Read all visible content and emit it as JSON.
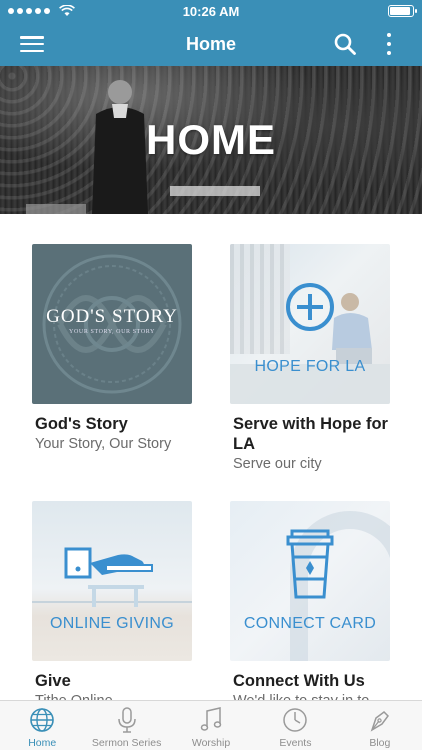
{
  "status_bar": {
    "time": "10:26 AM"
  },
  "nav": {
    "title": "Home"
  },
  "hero": {
    "title": "HOME"
  },
  "tiles": [
    {
      "image_title": "GOD'S STORY",
      "image_subtitle": "YOUR STORY, OUR STORY",
      "title": "God's Story",
      "subtitle": "Your Story, Our Story"
    },
    {
      "image_label": "HOPE FOR LA",
      "title": "Serve with Hope for LA",
      "subtitle": "Serve our city"
    },
    {
      "image_label": "ONLINE GIVING",
      "title": "Give",
      "subtitle": "Tithe Online"
    },
    {
      "image_label": "CONNECT CARD",
      "title": "Connect With Us",
      "subtitle": "We'd like to stay in to..."
    }
  ],
  "tabs": [
    {
      "label": "Home",
      "icon": "globe-icon",
      "active": true
    },
    {
      "label": "Sermon Series",
      "icon": "microphone-icon",
      "active": false
    },
    {
      "label": "Worship",
      "icon": "music-note-icon",
      "active": false
    },
    {
      "label": "Events",
      "icon": "clock-icon",
      "active": false
    },
    {
      "label": "Blog",
      "icon": "pen-nib-icon",
      "active": false
    }
  ],
  "colors": {
    "brand": "#3a8fb7",
    "tile_accent": "#3a8fcf",
    "tab_active": "#3a8fb7",
    "tab_inactive": "#8e8e8e"
  }
}
